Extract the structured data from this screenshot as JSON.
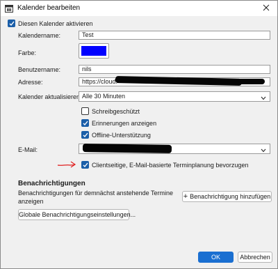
{
  "window": {
    "title": "Kalender bearbeiten",
    "icon": "calendar-icon"
  },
  "form": {
    "activate_label": "Diesen Kalender aktivieren",
    "activate_checked": true,
    "name_label": "Kalendername:",
    "name_value": "Test",
    "color_label": "Farbe:",
    "color_value": "#0000ff",
    "user_label": "Benutzername:",
    "user_value": "nils",
    "address_label": "Adresse:",
    "address_value": "https://cloud.",
    "refresh_label": "Kalender aktualisieren:",
    "refresh_value": "Alle 30 Minuten",
    "readonly_label": "Schreibgeschützt",
    "readonly_checked": false,
    "reminders_label": "Erinnerungen anzeigen",
    "reminders_checked": true,
    "offline_label": "Offline-Unterstützung",
    "offline_checked": true,
    "email_label": "E-Mail:",
    "clientside_label": "Clientseitige, E-Mail-basierte Terminplanung bevorzugen",
    "clientside_checked": true,
    "annotation_arrow_color": "#e02020"
  },
  "notifications": {
    "heading": "Benachrichtigungen",
    "description_line1": "Benachrichtigungen für demnächst anstehende Termine",
    "description_line2": "anzeigen",
    "add_button": "Benachrichtigung hinzufügen",
    "add_button_icon": "plus-icon",
    "global_settings_button": "Globale Benachrichtigungseinstellungen..."
  },
  "footer": {
    "ok_button": "OK",
    "cancel_button": "Abbrechen"
  }
}
